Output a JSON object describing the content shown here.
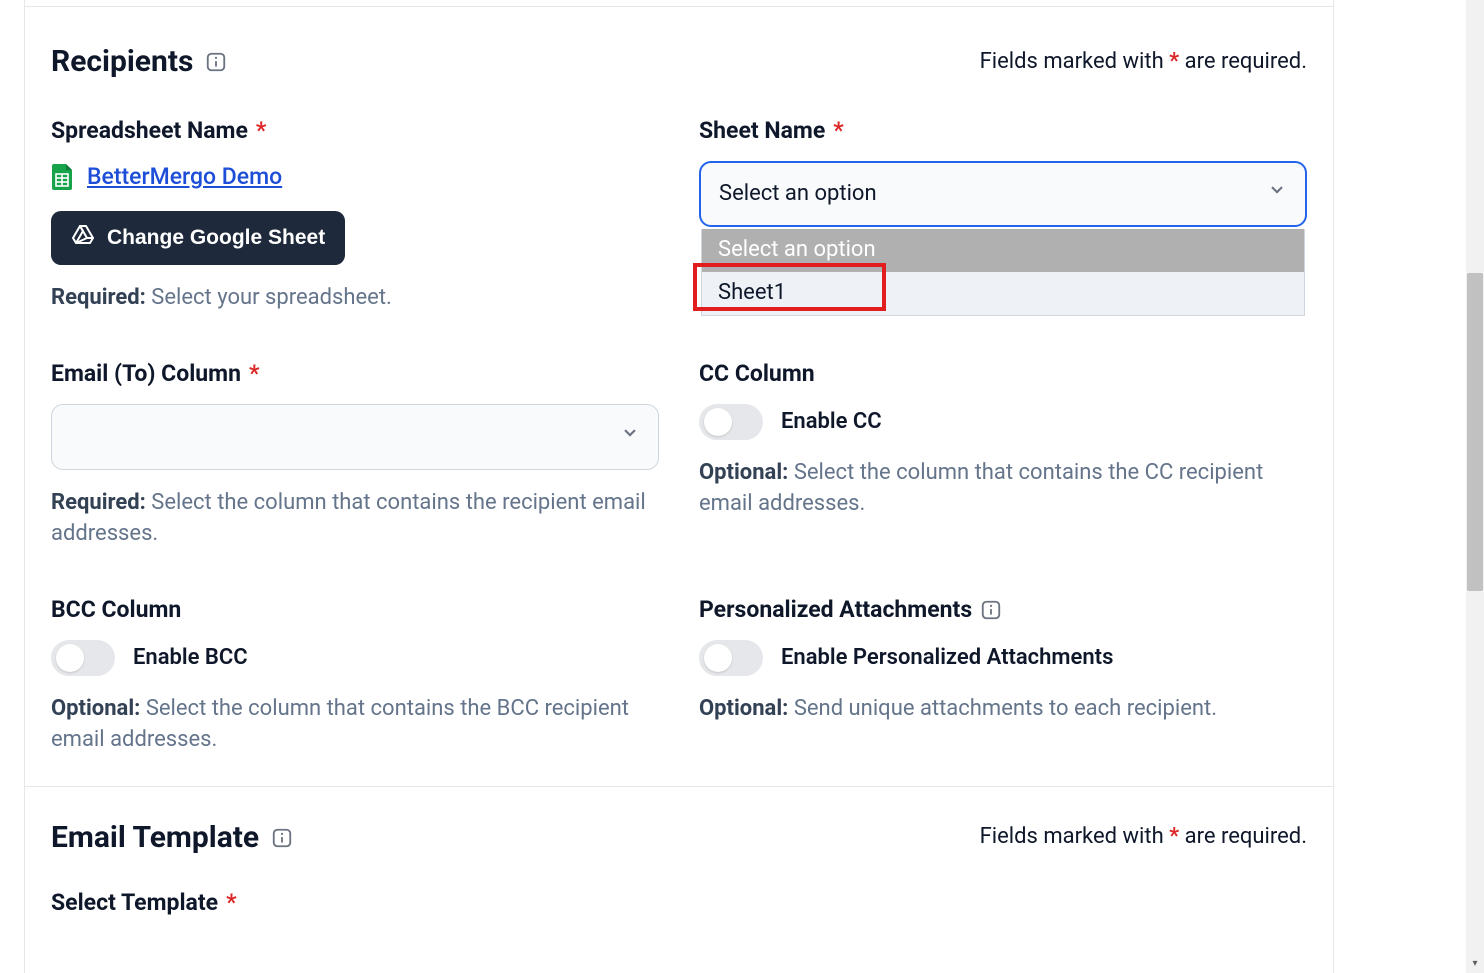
{
  "requiredNote": {
    "prefix": "Fields marked with ",
    "suffix": " are required."
  },
  "recipients": {
    "title": "Recipients",
    "spreadsheet": {
      "label": "Spreadsheet Name",
      "linkText": "BetterMergo Demo",
      "changeBtn": "Change Google Sheet",
      "helperBold": "Required:",
      "helperText": " Select your spreadsheet."
    },
    "sheetName": {
      "label": "Sheet Name",
      "selected": "Select an option",
      "options": {
        "placeholder": "Select an option",
        "sheet1": "Sheet1"
      }
    },
    "emailTo": {
      "label": "Email (To) Column",
      "helperBold": "Required:",
      "helperText": " Select the column that contains the recipient email addresses."
    },
    "cc": {
      "label": "CC Column",
      "toggleLabel": "Enable CC",
      "helperBold": "Optional:",
      "helperText": " Select the column that contains the CC recipient email addresses."
    },
    "bcc": {
      "label": "BCC Column",
      "toggleLabel": "Enable BCC",
      "helperBold": "Optional:",
      "helperText": " Select the column that contains the BCC recipient email addresses."
    },
    "attachments": {
      "label": "Personalized Attachments",
      "toggleLabel": "Enable Personalized Attachments",
      "helperBold": "Optional:",
      "helperText": " Send unique attachments to each recipient."
    }
  },
  "template": {
    "title": "Email Template",
    "selectTemplate": {
      "label": "Select Template"
    }
  }
}
